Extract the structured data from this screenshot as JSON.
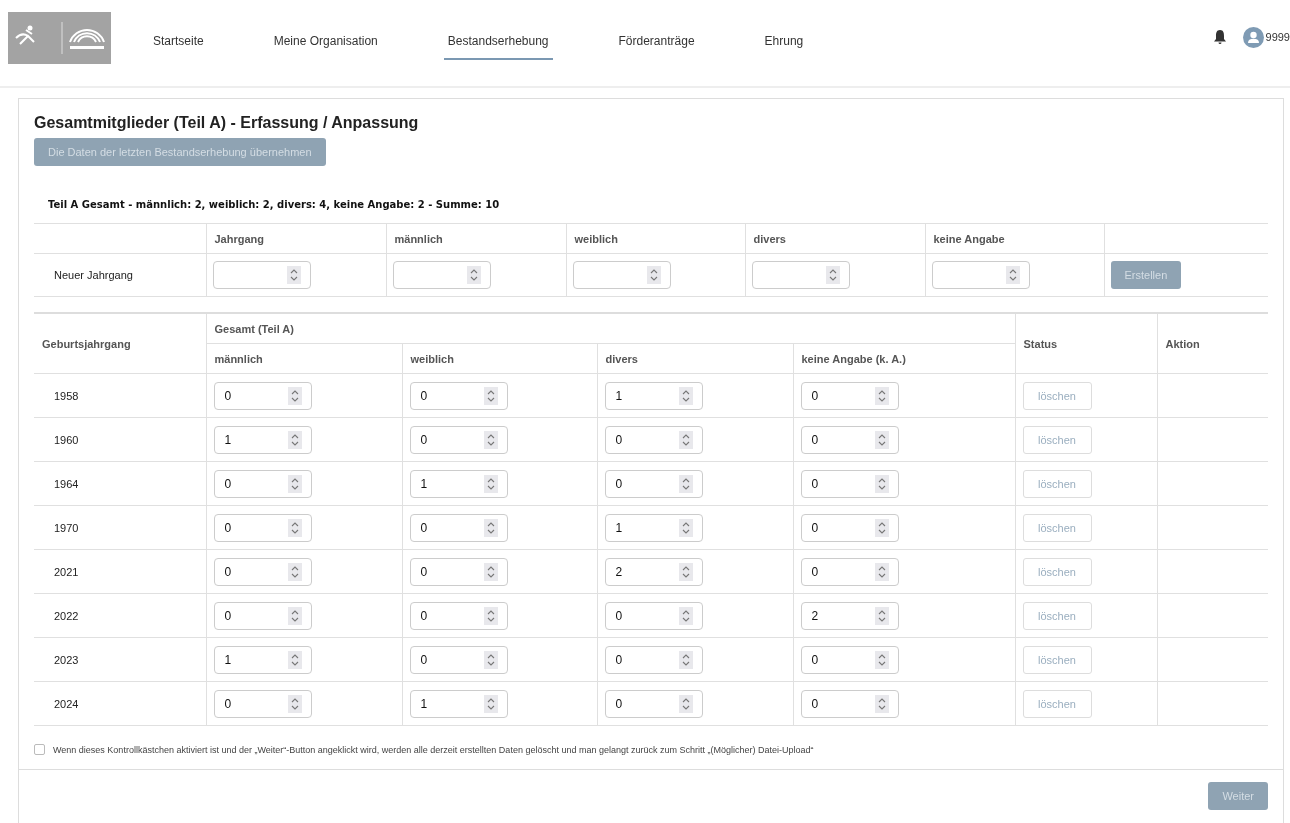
{
  "header": {
    "nav": [
      {
        "label": "Startseite",
        "selected": false
      },
      {
        "label": "Meine Organisation",
        "selected": false
      },
      {
        "label": "Bestandserhebung",
        "selected": true
      },
      {
        "label": "Förderanträge",
        "selected": false
      },
      {
        "label": "Ehrung",
        "selected": false
      }
    ],
    "user": "9999"
  },
  "title": "Gesamtmitglieder (Teil A) - Erfassung / Anpassung",
  "import_button": {
    "label": "Die Daten der letzten Bestandserhebung übernehmen",
    "disabled": true
  },
  "summary": "Teil A Gesamt - männlich: 2, weiblich: 2, divers: 4, keine Angabe: 2 - Summe: 10",
  "new_year_table": {
    "columns": [
      "Jahrgang",
      "männlich",
      "weiblich",
      "divers",
      "keine Angabe"
    ],
    "row_label": "Neuer Jahrgang",
    "create_button": {
      "label": "Erstellen",
      "disabled": true
    }
  },
  "years_table": {
    "first_column": "Geburtsjahrgang",
    "group_header": "Gesamt (Teil A)",
    "columns": [
      "männlich",
      "weiblich",
      "divers",
      "keine Angabe (k. A.)"
    ],
    "status_column": "Status",
    "action_column": "Aktion",
    "rows": [
      {
        "year": "1958",
        "values": [
          "0",
          "0",
          "1",
          "0"
        ],
        "action": "löschen"
      },
      {
        "year": "1960",
        "values": [
          "1",
          "0",
          "0",
          "0"
        ],
        "action": "löschen"
      },
      {
        "year": "1964",
        "values": [
          "0",
          "1",
          "0",
          "0"
        ],
        "action": "löschen"
      },
      {
        "year": "1970",
        "values": [
          "0",
          "0",
          "1",
          "0"
        ],
        "action": "löschen"
      },
      {
        "year": "2021",
        "values": [
          "0",
          "0",
          "2",
          "0"
        ],
        "action": "löschen"
      },
      {
        "year": "2022",
        "values": [
          "0",
          "0",
          "0",
          "2"
        ],
        "action": "löschen"
      },
      {
        "year": "2023",
        "values": [
          "1",
          "0",
          "0",
          "0"
        ],
        "action": "löschen"
      },
      {
        "year": "2024",
        "values": [
          "0",
          "1",
          "0",
          "0"
        ],
        "action": "löschen"
      }
    ]
  },
  "reset_checkbox": {
    "checked": false,
    "label": "Wenn dieses Kontrollkästchen aktiviert ist und der „Weiter“-Button angeklickt wird, werden alle derzeit erstellten Daten gelöscht und man gelangt zurück zum Schritt „(Möglicher) Datei-Upload“"
  },
  "next_button": {
    "label": "Weiter",
    "disabled": true
  }
}
